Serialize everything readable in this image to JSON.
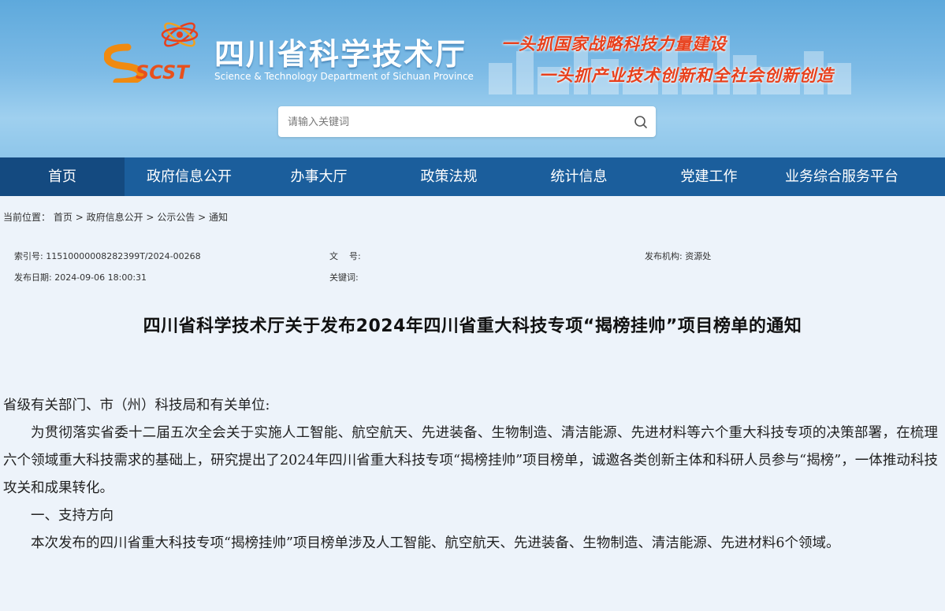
{
  "header": {
    "logo_text": "SCST",
    "title": "四川省科学技术厅",
    "subtitle_en": "Science & Technology Department of Sichuan Province",
    "slogan_line1": "一头抓国家战略科技力量建设",
    "slogan_line2": "一头抓产业技术创新和全社会创新创造"
  },
  "search": {
    "placeholder": "请输入关键词",
    "icon": "search-icon"
  },
  "nav": {
    "items": [
      {
        "label": "首页"
      },
      {
        "label": "政府信息公开"
      },
      {
        "label": "办事大厅"
      },
      {
        "label": "政策法规"
      },
      {
        "label": "统计信息"
      },
      {
        "label": "党建工作"
      },
      {
        "label": "业务综合服务平台"
      }
    ]
  },
  "breadcrumb": {
    "prefix": "当前位置：",
    "items": [
      "首页",
      "政府信息公开",
      "公示公告",
      "通知"
    ],
    "separator": ">"
  },
  "meta": {
    "index_label": "索引号:",
    "index_value": "11510000008282399T/2024-00268",
    "docno_label": "文    号:",
    "docno_value": "",
    "org_label": "发布机构:",
    "org_value": "资源处",
    "date_label": "发布日期:",
    "date_value": "2024-09-06 18:00:31",
    "keywords_label": "关键词:",
    "keywords_value": ""
  },
  "article": {
    "title": "四川省科学技术厅关于发布2024年四川省重大科技专项“揭榜挂帅”项目榜单的通知",
    "salutation": "省级有关部门、市（州）科技局和有关单位:",
    "para1": "为贯彻落实省委十二届五次全会关于实施人工智能、航空航天、先进装备、生物制造、清洁能源、先进材料等六个重大科技专项的决策部署，在梳理六个领域重大科技需求的基础上，研究提出了2024年四川省重大科技专项“揭榜挂帅”项目榜单，诚邀各类创新主体和科研人员参与“揭榜”，一体推动科技攻关和成果转化。",
    "section1": "一、支持方向",
    "para2": "本次发布的四川省重大科技专项“揭榜挂帅”项目榜单涉及人工智能、航空航天、先进装备、生物制造、清洁能源、先进材料6个领域。"
  },
  "colors": {
    "nav_bg": "#1b5e9c",
    "nav_active": "#144a80",
    "slogan": "#e8401c",
    "page_bg": "#edf3fa"
  }
}
